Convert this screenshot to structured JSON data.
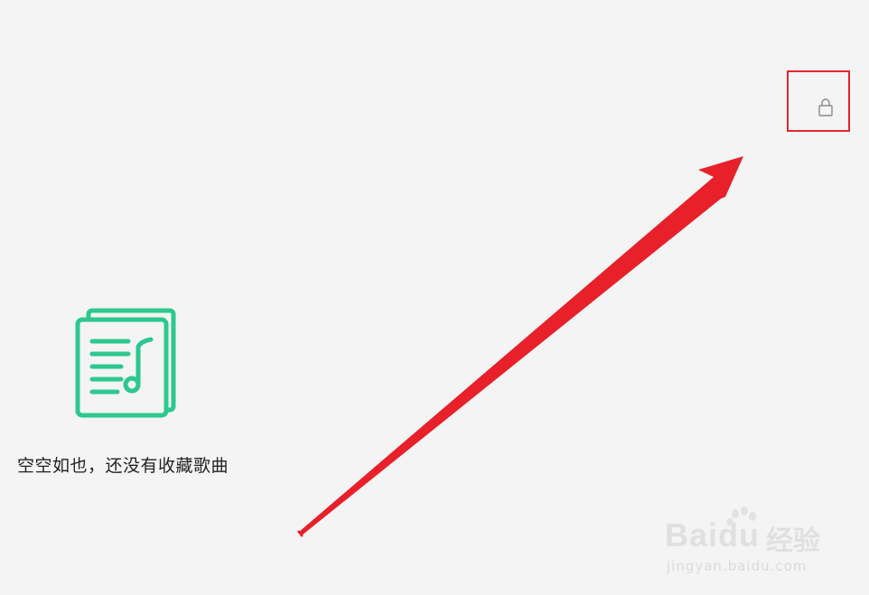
{
  "toolbar": {
    "lock_icon": "lock-icon"
  },
  "empty_state": {
    "icon": "music-list-icon",
    "message": "空空如也，还没有收藏歌曲"
  },
  "annotation": {
    "highlight_color": "#e2272f",
    "arrow_color": "#e8202a"
  },
  "watermark": {
    "logo_text": "Baidu",
    "logo_suffix": "经验",
    "url": "jingyan.baidu.com"
  },
  "colors": {
    "background": "#f4f4f4",
    "icon_accent": "#2dc88f"
  }
}
